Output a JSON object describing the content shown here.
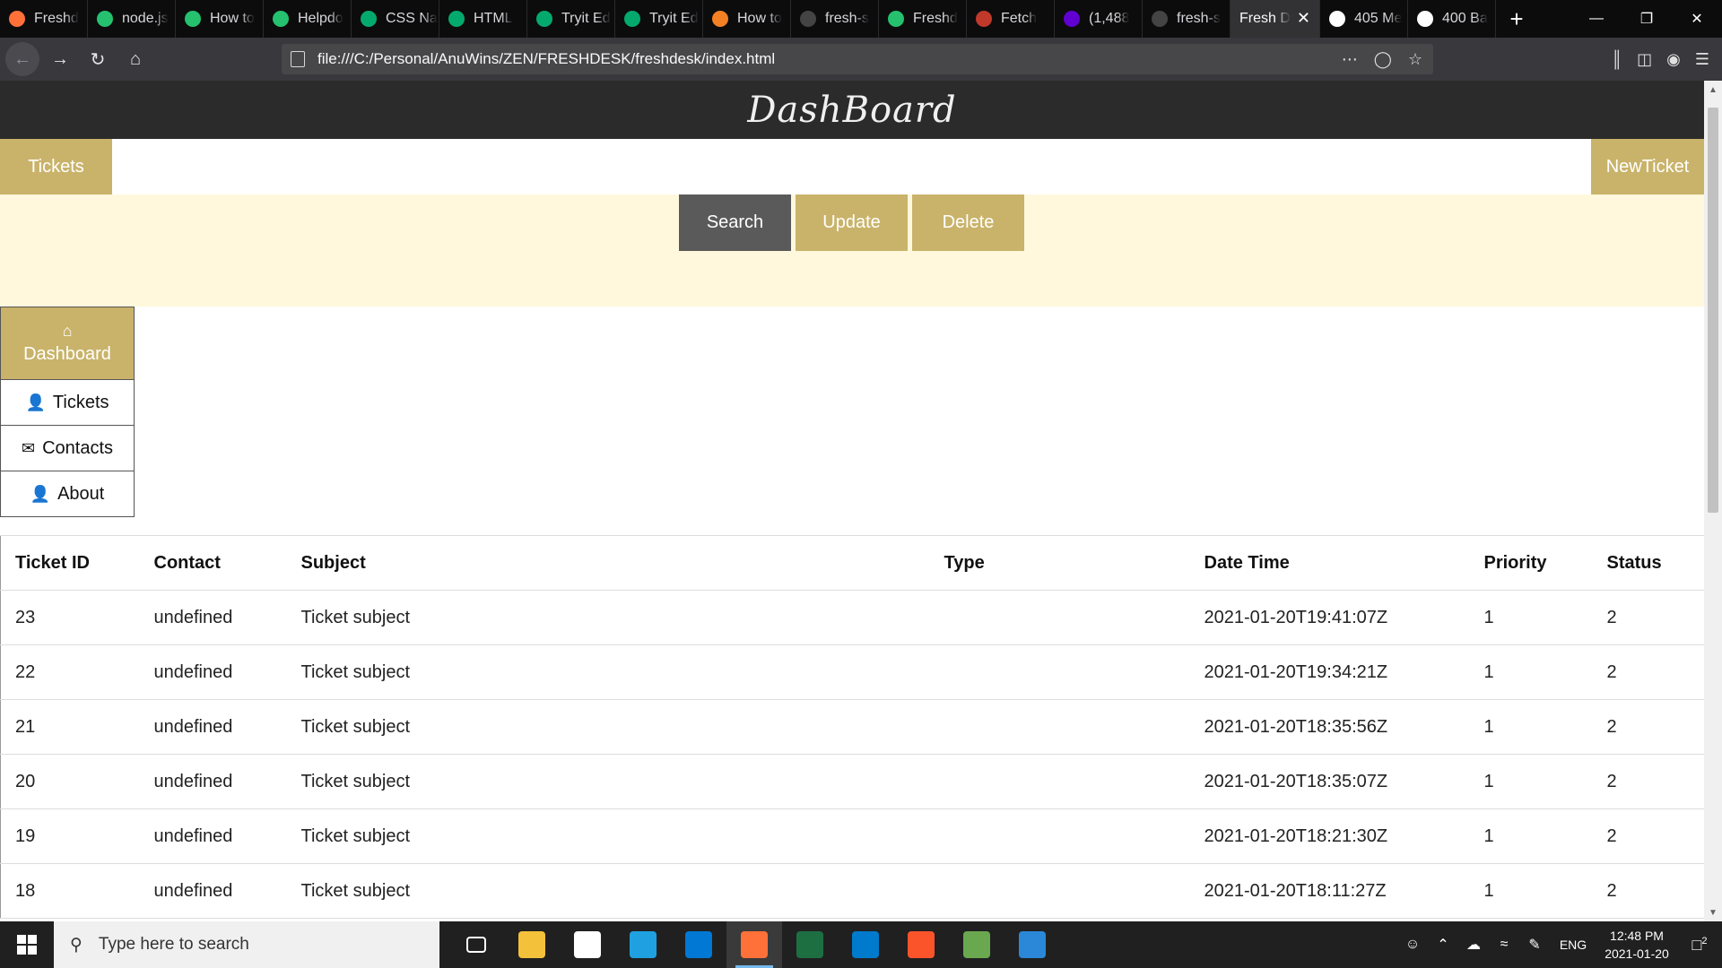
{
  "browser": {
    "tabs": [
      {
        "label": "Freshd",
        "icon": "firefox-icon",
        "color": "#ff7139"
      },
      {
        "label": "node.js",
        "icon": "freshdesk-icon",
        "color": "#25c16f"
      },
      {
        "label": "How to",
        "icon": "freshdesk-icon",
        "color": "#25c16f"
      },
      {
        "label": "Helpdo",
        "icon": "freshdesk-icon",
        "color": "#25c16f"
      },
      {
        "label": "CSS Na",
        "icon": "w3schools-icon",
        "color": "#04aa6d"
      },
      {
        "label": "HTML",
        "icon": "w3schools-icon",
        "color": "#04aa6d"
      },
      {
        "label": "Tryit Ed",
        "icon": "w3schools-icon",
        "color": "#04aa6d"
      },
      {
        "label": "Tryit Ed",
        "icon": "w3schools-icon",
        "color": "#04aa6d"
      },
      {
        "label": "How to",
        "icon": "stackoverflow-icon",
        "color": "#f48024"
      },
      {
        "label": "fresh-s",
        "icon": "github-icon",
        "color": "#444"
      },
      {
        "label": "Freshd",
        "icon": "freshdesk-icon",
        "color": "#25c16f"
      },
      {
        "label": "Fetch",
        "icon": "fetch-icon",
        "color": "#c0392b"
      },
      {
        "label": "(1,488",
        "icon": "yahoo-mail-icon",
        "color": "#6001d2"
      },
      {
        "label": "fresh-s",
        "icon": "github-icon",
        "color": "#444"
      },
      {
        "label": "Fresh D",
        "icon": "none",
        "color": "#323234",
        "active": true
      },
      {
        "label": "405 Me",
        "icon": "postman-icon",
        "color": "#fff"
      },
      {
        "label": "400 Ba",
        "icon": "postman-icon",
        "color": "#fff"
      }
    ],
    "url": "file:///C:/Personal/AnuWins/ZEN/FRESHDESK/freshdesk/index.html"
  },
  "header": {
    "title": "DashBoard"
  },
  "topnav": {
    "left_tab": "Tickets",
    "right_tab": "NewTicket"
  },
  "actions": {
    "search": "Search",
    "update": "Update",
    "delete": "Delete"
  },
  "sidenav": {
    "items": [
      {
        "label": "Dashboard",
        "icon": "home-icon",
        "glyph": "⌂"
      },
      {
        "label": "Tickets",
        "icon": "user-icon",
        "glyph": "👤"
      },
      {
        "label": "Contacts",
        "icon": "envelope-icon",
        "glyph": "✉"
      },
      {
        "label": "About",
        "icon": "user-icon",
        "glyph": "👤"
      }
    ]
  },
  "table": {
    "headers": [
      "Ticket ID",
      "Contact",
      "Subject",
      "Type",
      "Date Time",
      "Priority",
      "Status"
    ],
    "rows": [
      [
        "23",
        "undefined",
        "Ticket subject",
        "",
        "2021-01-20T19:41:07Z",
        "1",
        "2"
      ],
      [
        "22",
        "undefined",
        "Ticket subject",
        "",
        "2021-01-20T19:34:21Z",
        "1",
        "2"
      ],
      [
        "21",
        "undefined",
        "Ticket subject",
        "",
        "2021-01-20T18:35:56Z",
        "1",
        "2"
      ],
      [
        "20",
        "undefined",
        "Ticket subject",
        "",
        "2021-01-20T18:35:07Z",
        "1",
        "2"
      ],
      [
        "19",
        "undefined",
        "Ticket subject",
        "",
        "2021-01-20T18:21:30Z",
        "1",
        "2"
      ],
      [
        "18",
        "undefined",
        "Ticket subject",
        "",
        "2021-01-20T18:11:27Z",
        "1",
        "2"
      ]
    ]
  },
  "taskbar": {
    "search_placeholder": "Type here to search",
    "apps": [
      {
        "name": "task-view-icon",
        "color": "#202020"
      },
      {
        "name": "file-explorer-icon",
        "color": "#f3c13a"
      },
      {
        "name": "store-icon",
        "color": "#ffffff"
      },
      {
        "name": "edge-icon",
        "color": "#1fa1e1"
      },
      {
        "name": "mail-icon",
        "color": "#0078d4"
      },
      {
        "name": "firefox-icon",
        "color": "#ff7139",
        "active": true
      },
      {
        "name": "excel-icon",
        "color": "#1d6f42"
      },
      {
        "name": "vscode-icon",
        "color": "#007acc"
      },
      {
        "name": "brave-icon",
        "color": "#fb542b"
      },
      {
        "name": "notepad-icon",
        "color": "#6aa84f"
      },
      {
        "name": "photos-icon",
        "color": "#2b88d8"
      }
    ],
    "lang": "ENG",
    "time": "12:48 PM",
    "date": "2021-01-20",
    "notifications": "2"
  },
  "theme": {
    "accent": "#c9b36a",
    "header_bg": "#2b2b2b",
    "action_bg": "#fff8dd",
    "search_btn": "#5a5a5a"
  }
}
